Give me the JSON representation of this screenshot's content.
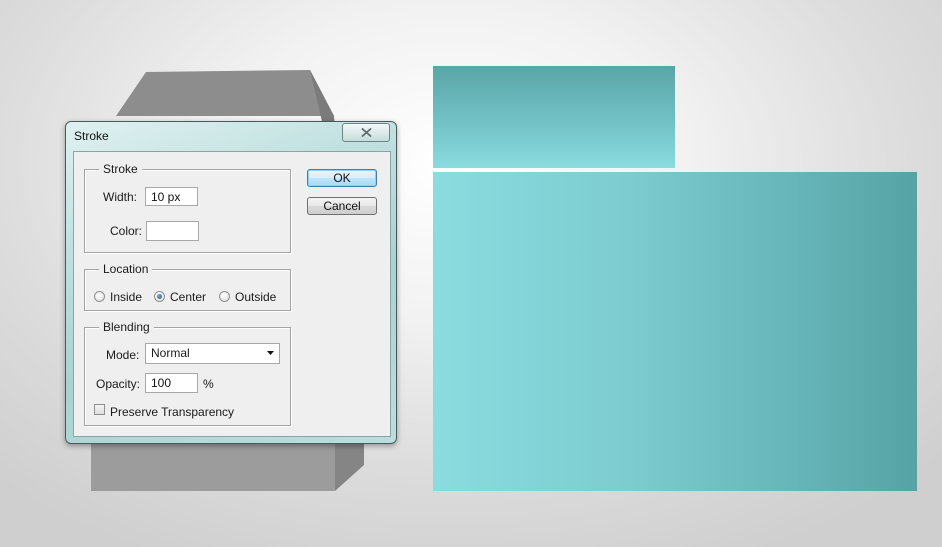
{
  "dialog": {
    "title": "Stroke",
    "ok_label": "OK",
    "cancel_label": "Cancel",
    "stroke_group": {
      "legend": "Stroke",
      "width_label": "Width:",
      "width_value": "10 px",
      "color_label": "Color:",
      "color_value": "#ffffff"
    },
    "location_group": {
      "legend": "Location",
      "options": [
        "Inside",
        "Center",
        "Outside"
      ],
      "selected": "Center"
    },
    "blending_group": {
      "legend": "Blending",
      "mode_label": "Mode:",
      "mode_value": "Normal",
      "opacity_label": "Opacity:",
      "opacity_value": "100",
      "opacity_unit": "%",
      "preserve_label": "Preserve Transparency",
      "preserve_checked": false
    }
  },
  "colors": {
    "teal_light": "#8adcdf",
    "teal_dark": "#56a3a5",
    "gray_box": "#9a9a9a",
    "ok_focus": "#3c7fb1"
  },
  "icons": {
    "close": "close-icon",
    "dropdown": "chevron-down-icon"
  }
}
